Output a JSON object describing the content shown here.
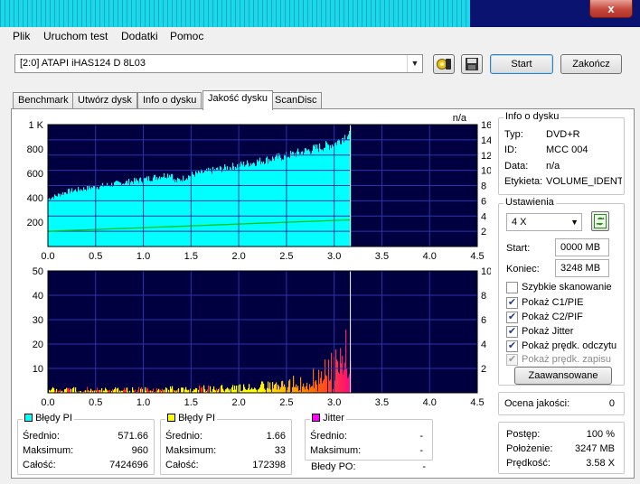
{
  "menu": [
    "Plik",
    "Uruchom test",
    "Dodatki",
    "Pomoc"
  ],
  "window": {
    "close_glyph": "x"
  },
  "toolbar": {
    "drive": "[2:0]   ATAPI iHAS124   D 8L03",
    "start_label": "Start",
    "stop_label": "Zakończ",
    "icons": [
      "settings-icon",
      "save-icon"
    ]
  },
  "tabs": [
    "Benchmark",
    "Utwórz dysk",
    "Info o dysku",
    "Jakość dysku",
    "ScanDisc"
  ],
  "active_tab": 3,
  "disc_info": {
    "title": "Info o dysku",
    "rows": [
      {
        "label": "Typ:",
        "value": "DVD+R"
      },
      {
        "label": "ID:",
        "value": "MCC 004"
      },
      {
        "label": "Data:",
        "value": "n/a"
      },
      {
        "label": "Etykieta:",
        "value": "VOLUME_IDENTI"
      }
    ]
  },
  "settings": {
    "title": "Ustawienia",
    "speed": "4 X",
    "start_label": "Start:",
    "start_value": "0000 MB",
    "end_label": "Koniec:",
    "end_value": "3248 MB",
    "checkboxes": [
      {
        "label": "Szybkie skanowanie",
        "checked": false,
        "disabled": false
      },
      {
        "label": "Pokaż C1/PIE",
        "checked": true,
        "disabled": false
      },
      {
        "label": "Pokaż C2/PIF",
        "checked": true,
        "disabled": false
      },
      {
        "label": "Pokaż Jitter",
        "checked": true,
        "disabled": false
      },
      {
        "label": "Pokaż prędk. odczytu",
        "checked": true,
        "disabled": false
      },
      {
        "label": "Pokaż prędk. zapisu",
        "checked": true,
        "disabled": true
      }
    ],
    "advanced_label": "Zaawansowane"
  },
  "quality": {
    "label": "Ocena jakości:",
    "value": "0"
  },
  "progress": {
    "rows": [
      {
        "label": "Postęp:",
        "value": "100 %"
      },
      {
        "label": "Położenie:",
        "value": "3247 MB"
      },
      {
        "label": "Prędkość:",
        "value": "3.58 X"
      }
    ]
  },
  "stats": {
    "pi": {
      "title": "Błędy PI",
      "color": "#00ffff",
      "rows": [
        {
          "label": "Średnio:",
          "value": "571.66"
        },
        {
          "label": "Maksimum:",
          "value": "960"
        },
        {
          "label": "Całość:",
          "value": "7424696"
        }
      ]
    },
    "pif": {
      "title": "Błędy PI",
      "color": "#ffff00",
      "rows": [
        {
          "label": "Średnio:",
          "value": "1.66"
        },
        {
          "label": "Maksimum:",
          "value": "33"
        },
        {
          "label": "Całość:",
          "value": "172398"
        }
      ]
    },
    "jitter": {
      "title": "Jitter",
      "color": "#ff00ff",
      "rows": [
        {
          "label": "Średnio:",
          "value": "-"
        },
        {
          "label": "Maksimum:",
          "value": "-"
        }
      ]
    },
    "po": {
      "label": "Błedy PO:",
      "value": "-"
    }
  },
  "chart_data": [
    {
      "type": "bar",
      "name": "pie-chart-top",
      "corner_label": "n/a",
      "xlim": [
        0,
        4.5
      ],
      "x_ticks": [
        "0.0",
        "0.5",
        "1.0",
        "1.5",
        "2.0",
        "2.5",
        "3.0",
        "3.5",
        "4.0",
        "4.5"
      ],
      "ylim": [
        0,
        1000
      ],
      "y_ticks": [
        "1 K",
        "800",
        "600",
        "400",
        "200"
      ],
      "y_tick_values": [
        1000,
        800,
        600,
        400,
        200
      ],
      "y2lim": [
        0,
        16
      ],
      "y2_ticks": [
        "16",
        "14",
        "12",
        "10",
        "8",
        "6",
        "4",
        "2"
      ],
      "y2_tick_values": [
        16,
        14,
        12,
        10,
        8,
        6,
        4,
        2
      ],
      "grid": true,
      "background": "#000040",
      "series": [
        {
          "color": "#00ffff",
          "x": [
            0,
            0.2,
            0.5,
            1.0,
            1.3,
            1.32,
            1.5,
            2.0,
            2.5,
            3.0,
            3.17
          ],
          "values": [
            400,
            460,
            500,
            560,
            610,
            540,
            600,
            680,
            760,
            860,
            960
          ]
        },
        {
          "color": "#00c000",
          "x": [
            0,
            3.17
          ],
          "values": [
            2.0,
            3.5
          ]
        }
      ],
      "marker_x": 3.17
    },
    {
      "type": "bar",
      "name": "pif-chart-bottom",
      "xlim": [
        0,
        4.5
      ],
      "x_ticks": [
        "0.0",
        "0.5",
        "1.0",
        "1.5",
        "2.0",
        "2.5",
        "3.0",
        "3.5",
        "4.0",
        "4.5"
      ],
      "ylim": [
        0,
        50
      ],
      "y_ticks": [
        "50",
        "40",
        "30",
        "20",
        "10"
      ],
      "y_tick_values": [
        50,
        40,
        30,
        20,
        10
      ],
      "y2lim": [
        0,
        10
      ],
      "y2_ticks": [
        "10",
        "8",
        "6",
        "4",
        "2"
      ],
      "y2_tick_values": [
        10,
        8,
        6,
        4,
        2
      ],
      "grid": true,
      "background": "#000040",
      "series": [
        {
          "color": "#ffff00",
          "x": [
            0,
            1.0,
            2.0,
            2.5,
            2.8,
            3.0,
            3.1,
            3.17
          ],
          "values": [
            2,
            2,
            3,
            5,
            9,
            15,
            22,
            33
          ]
        }
      ],
      "marker_x": 3.17
    }
  ]
}
